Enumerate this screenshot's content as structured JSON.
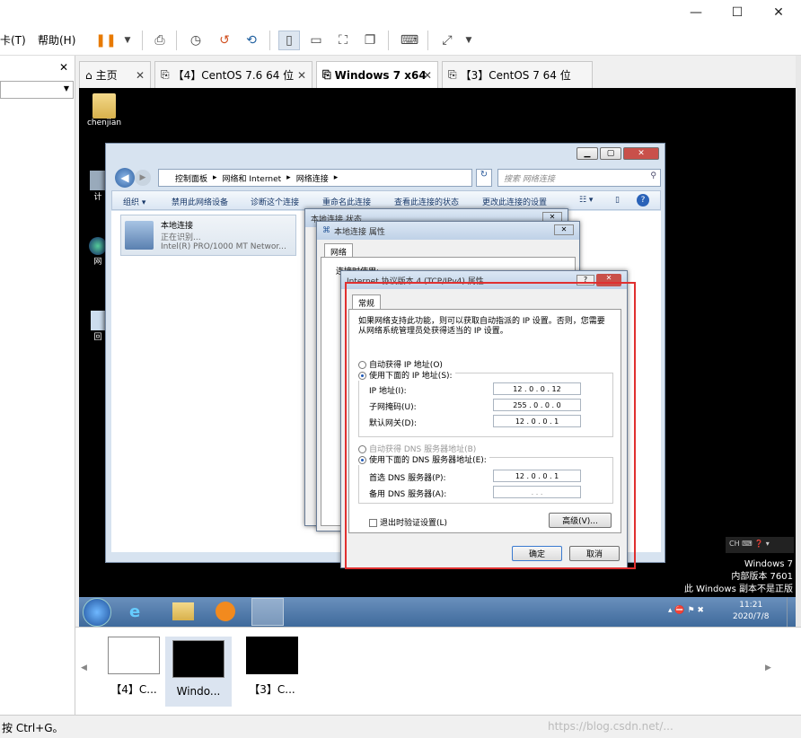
{
  "titlebar": {
    "minimize": "—",
    "maximize": "☐",
    "close": "✕"
  },
  "menubar": {
    "items": [
      "卡(T)",
      "帮助(H)"
    ]
  },
  "left_panel": {
    "close": "✕"
  },
  "tabs": [
    {
      "label": "主页"
    },
    {
      "label": "【4】CentOS 7.6 64 位"
    },
    {
      "label": "Windows 7 x64"
    },
    {
      "label": "【3】CentOS 7 64 位"
    }
  ],
  "desktop": {
    "user_icon_label": "chenjian",
    "icon_labels": [
      "计",
      "网",
      "回"
    ]
  },
  "explorer": {
    "breadcrumb": [
      "控制面板",
      "网络和 Internet",
      "网络连接"
    ],
    "search_placeholder": "搜索 网络连接",
    "commands": [
      "组织 ▾",
      "禁用此网络设备",
      "诊断这个连接",
      "重命名此连接",
      "查看此连接的状态",
      "更改此连接的设置"
    ],
    "connection": {
      "name": "本地连接",
      "status": "正在识别...",
      "adapter": "Intel(R) PRO/1000 MT Networ..."
    }
  },
  "status_dialog": {
    "title": "本地连接 状态"
  },
  "props_dialog": {
    "title": "本地连接 属性",
    "tab": "网络",
    "connect_using": "连接时使用:"
  },
  "ipv4_dialog": {
    "title": "Internet 协议版本 4 (TCP/IPv4) 属性",
    "tab": "常规",
    "intro": "如果网络支持此功能，则可以获取自动指派的 IP 设置。否则，您需要从网络系统管理员处获得适当的 IP 设置。",
    "auto_ip": "自动获得 IP 地址(O)",
    "manual_ip": "使用下面的 IP 地址(S):",
    "ip_label": "IP 地址(I):",
    "ip_value": "12 . 0 . 0 . 12",
    "mask_label": "子网掩码(U):",
    "mask_value": "255 . 0 . 0 . 0",
    "gateway_label": "默认网关(D):",
    "gateway_value": "12 . 0 . 0 . 1",
    "auto_dns": "自动获得 DNS 服务器地址(B)",
    "manual_dns": "使用下面的 DNS 服务器地址(E):",
    "pref_dns_label": "首选 DNS 服务器(P):",
    "pref_dns_value": "12 . 0 . 0 . 1",
    "alt_dns_label": "备用 DNS 服务器(A):",
    "alt_dns_value": ". . .",
    "validate": "退出时验证设置(L)",
    "advanced": "高级(V)...",
    "ok": "确定",
    "cancel": "取消"
  },
  "watermark": {
    "line1": "Windows 7",
    "line2": "内部版本 7601",
    "line3": "此 Windows 副本不是正版"
  },
  "tray": {
    "lang": "CH",
    "time": "11:21",
    "date": "2020/7/8"
  },
  "thumbnails": [
    {
      "label": "【4】C..."
    },
    {
      "label": "Windo..."
    },
    {
      "label": "【3】C..."
    }
  ],
  "statusbar": {
    "text": "按 Ctrl+G。",
    "url": "https://blog.csdn.net/..."
  },
  "colors": {
    "highlight": "#e03030",
    "vm_bg": "#000000",
    "taskbar": "#4a74a6"
  }
}
